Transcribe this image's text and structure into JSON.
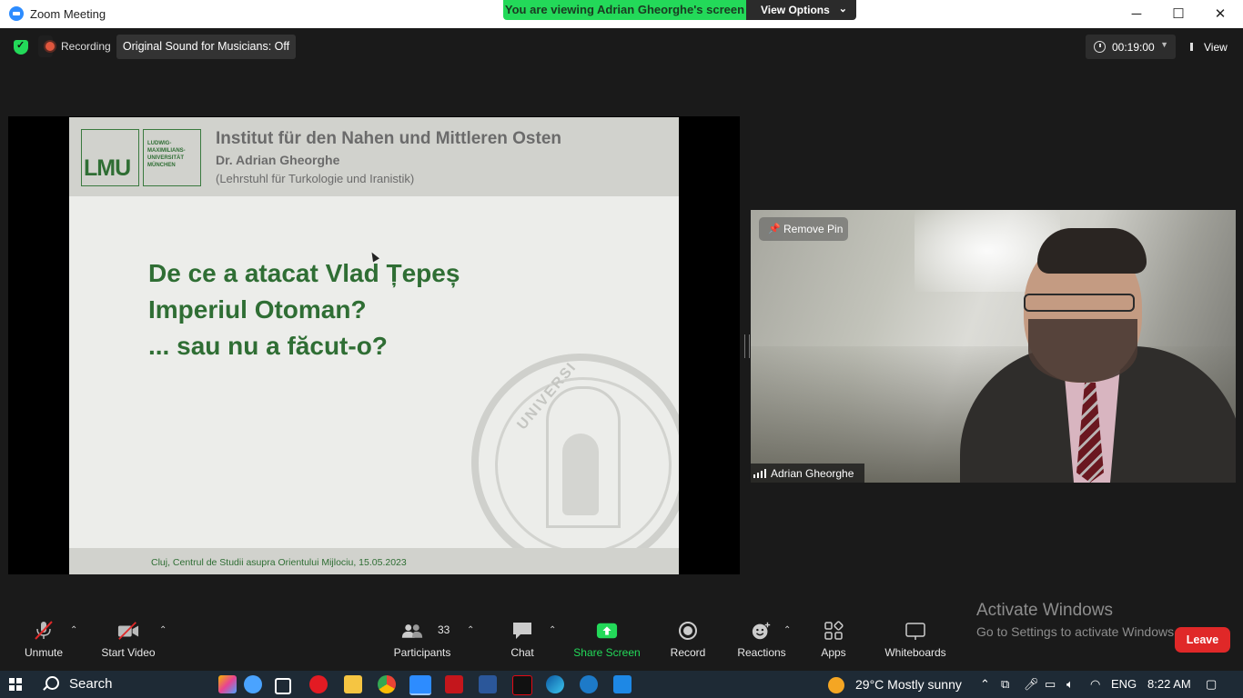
{
  "window": {
    "title": "Zoom Meeting",
    "minimize": "─",
    "maximize": "☐",
    "close": "✕"
  },
  "banner": {
    "viewing": "You are viewing Adrian Gheorghe's screen",
    "view_options": "View Options",
    "chevron": "⌄"
  },
  "topbar": {
    "recording": "Recording",
    "original_sound": "Original Sound for Musicians: Off",
    "timer": "00:19:00",
    "view": "View"
  },
  "slide": {
    "logo_mark": "LMU",
    "logo_text": "LUDWIG-\nMAXIMILIANS-\nUNIVERSITÄT\nMÜNCHEN",
    "institute": "Institut für den Nahen und Mittleren Osten",
    "author": "Dr. Adrian Gheorghe",
    "chair": "(Lehrstuhl für Turkologie und Iranistik)",
    "question_lines": [
      "De ce a atacat Vlad Țepeș",
      "Imperiul Otoman?",
      "... sau nu a făcut-o?"
    ],
    "seal_word": "UNIVERSI",
    "footer": "Cluj, Centrul de Studii asupra Orientului Mijlociu, 15.05.2023"
  },
  "video": {
    "remove_pin": "Remove Pin",
    "participant_name": "Adrian Gheorghe"
  },
  "watermark": {
    "line1": "Activate Windows",
    "line2": "Go to Settings to activate Windows."
  },
  "toolbar": {
    "unmute": "Unmute",
    "start_video": "Start Video",
    "participants": "Participants",
    "participants_count": "33",
    "chat": "Chat",
    "share_screen": "Share Screen",
    "record": "Record",
    "reactions": "Reactions",
    "apps": "Apps",
    "whiteboards": "Whiteboards",
    "leave": "Leave",
    "share_color": "#23d959"
  },
  "taskbar": {
    "search": "Search",
    "weather": "29°C  Mostly sunny",
    "language": "ENG",
    "time": "8:22 AM"
  }
}
